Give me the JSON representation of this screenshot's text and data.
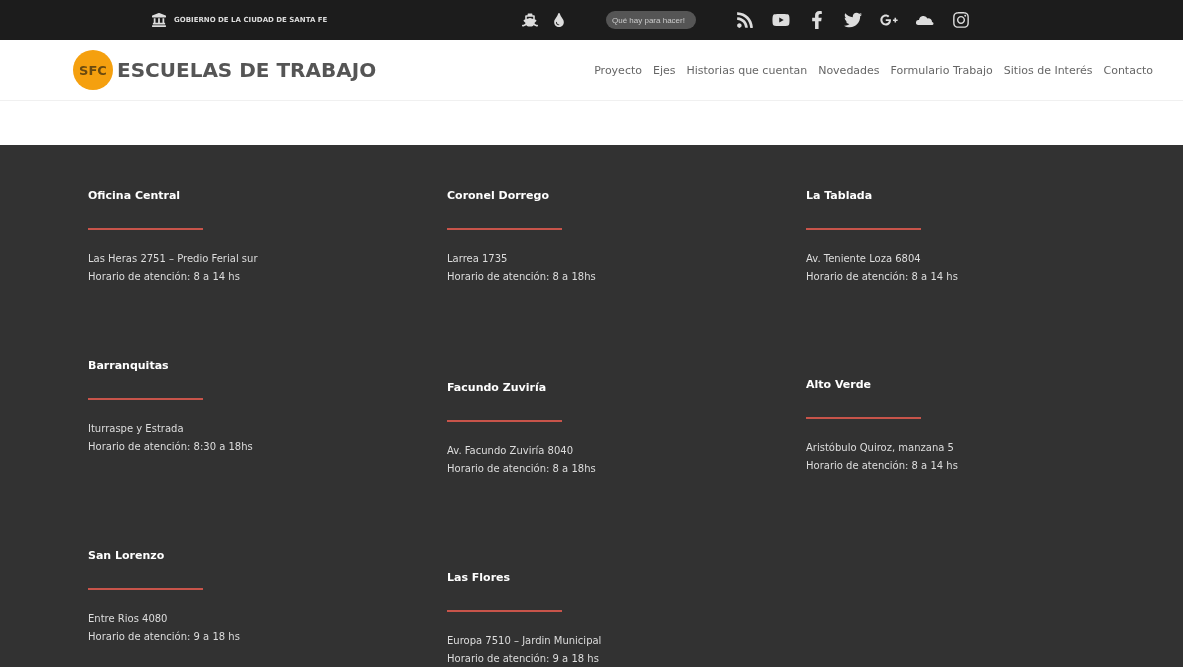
{
  "top_bar": {
    "government": "GOBIERNO DE LA CIUDAD DE SANTA FE",
    "search": {
      "placeholder": "Qué hay para hacer!"
    }
  },
  "header": {
    "logo_mark": "SFC",
    "title": "ESCUELAS DE TRABAJO",
    "nav": [
      "Proyecto",
      "Ejes",
      "Historias que cuentan",
      "Novedades",
      "Formulario Trabajo",
      "Sitios de Interés",
      "Contacto"
    ]
  },
  "offices": [
    [
      {
        "name": "Oficina Central",
        "address": "Las Heras 2751 – Predio Ferial sur",
        "hours": "Horario de atención: 8 a 14 hs"
      },
      {
        "name": "Barranquitas",
        "address": "Iturraspe y Estrada",
        "hours": "Horario de atención: 8:30 a 18hs"
      },
      {
        "name": "San Lorenzo",
        "address": "Entre Rios 4080",
        "hours": "Horario de atención: 9 a 18 hs"
      }
    ],
    [
      {
        "name": "Coronel Dorrego",
        "address": "Larrea 1735",
        "hours": "Horario de atención: 8 a 18hs"
      },
      {
        "name": "Facundo Zuviría",
        "address": "Av. Facundo Zuviría 8040",
        "hours": "Horario de atención: 8 a 18hs"
      },
      {
        "name": "Las Flores",
        "address": "Europa 7510 – Jardin Municipal",
        "hours": "Horario de atención: 9 a 18 hs"
      }
    ],
    [
      {
        "name": "La Tablada",
        "address": "Av. Teniente Loza 6804",
        "hours": "Horario de atención: 8 a 14 hs"
      },
      {
        "name": "Alto Verde",
        "address": "Aristóbulo Quiroz, manzana 5",
        "hours": "Horario de atención: 8 a 14 hs"
      }
    ]
  ]
}
